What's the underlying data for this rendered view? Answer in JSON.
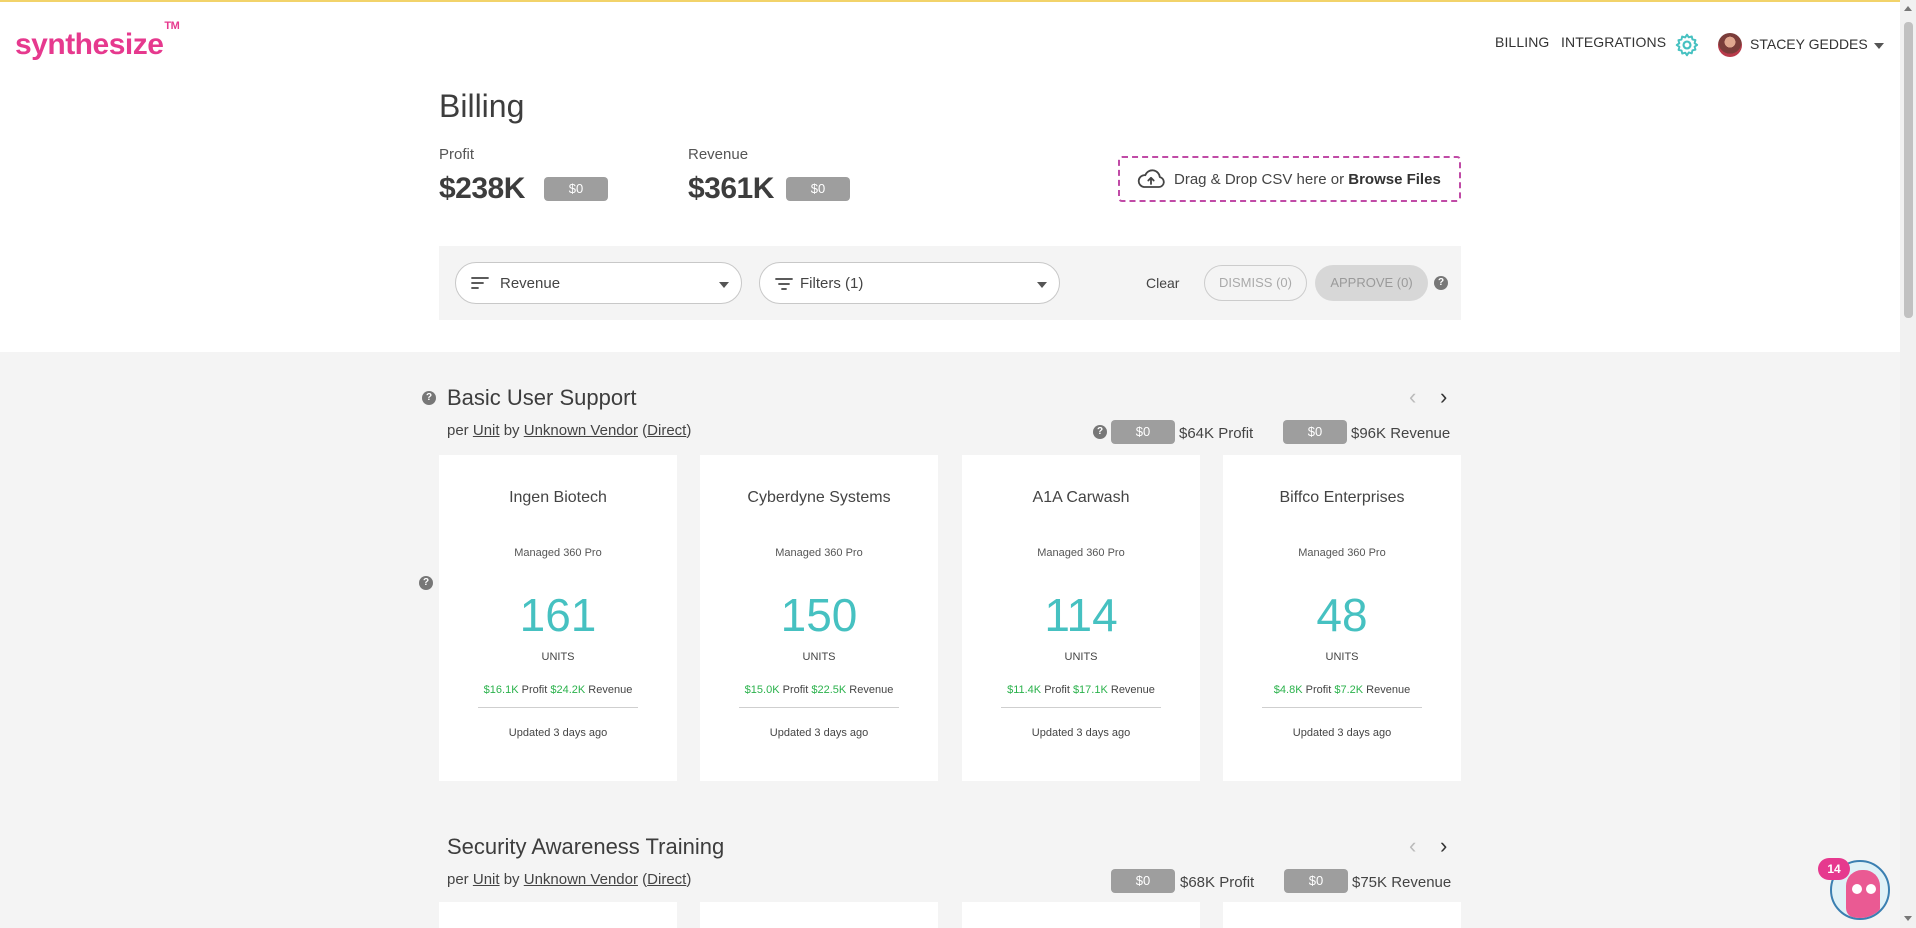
{
  "app": {
    "logo": "synthesize",
    "logo_tm": "TM"
  },
  "nav": {
    "billing": "BILLING",
    "integrations": "INTEGRATIONS",
    "settings_icon": "gear-icon",
    "user_name": "STACEY GEDDES"
  },
  "page": {
    "title": "Billing"
  },
  "stats": {
    "profit_label": "Profit",
    "profit_value": "$238K",
    "profit_pill": "$0",
    "revenue_label": "Revenue",
    "revenue_value": "$361K",
    "revenue_pill": "$0"
  },
  "upload": {
    "text": "Drag & Drop CSV here or ",
    "link": "Browse Files"
  },
  "filters": {
    "sort_value": "Revenue",
    "filter_value": "Filters (1)",
    "clear": "Clear",
    "dismiss": "DISMISS (0)",
    "approve": "APPROVE (0)"
  },
  "sections": [
    {
      "title": "Basic User Support",
      "per": "per ",
      "unit": "Unit",
      "by": " by ",
      "vendor": "Unknown Vendor",
      "open_paren": " (",
      "channel": "Direct",
      "close_paren": ")",
      "profit_pill": "$0",
      "profit_text": "$64K Profit",
      "revenue_pill": "$0",
      "revenue_text": "$96K Revenue",
      "cards": [
        {
          "customer": "Ingen Biotech",
          "product": "Managed 360 Pro",
          "units": "161",
          "units_label": "UNITS",
          "profit": "$16.1K",
          "profit_label": " Profit ",
          "revenue": "$24.2K",
          "revenue_label": " Revenue",
          "updated": "Updated 3 days ago"
        },
        {
          "customer": "Cyberdyne Systems",
          "product": "Managed 360 Pro",
          "units": "150",
          "units_label": "UNITS",
          "profit": "$15.0K",
          "profit_label": " Profit ",
          "revenue": "$22.5K",
          "revenue_label": " Revenue",
          "updated": "Updated 3 days ago"
        },
        {
          "customer": "A1A Carwash",
          "product": "Managed 360 Pro",
          "units": "114",
          "units_label": "UNITS",
          "profit": "$11.4K",
          "profit_label": " Profit ",
          "revenue": "$17.1K",
          "revenue_label": " Revenue",
          "updated": "Updated 3 days ago"
        },
        {
          "customer": "Biffco Enterprises",
          "product": "Managed 360 Pro",
          "units": "48",
          "units_label": "UNITS",
          "profit": "$4.8K",
          "profit_label": " Profit ",
          "revenue": "$7.2K",
          "revenue_label": " Revenue",
          "updated": "Updated 3 days ago"
        }
      ]
    },
    {
      "title": "Security Awareness Training",
      "per": "per ",
      "unit": "Unit",
      "by": " by ",
      "vendor": "Unknown Vendor",
      "open_paren": " (",
      "channel": "Direct",
      "close_paren": ")",
      "profit_pill": "$0",
      "profit_text": "$68K Profit",
      "revenue_pill": "$0",
      "revenue_text": "$75K Revenue"
    }
  ],
  "chat": {
    "badge": "14"
  },
  "colors": {
    "brand": "#e6398e",
    "teal": "#46c1c1",
    "green": "#2bb24c",
    "pill": "#9e9e9e"
  }
}
